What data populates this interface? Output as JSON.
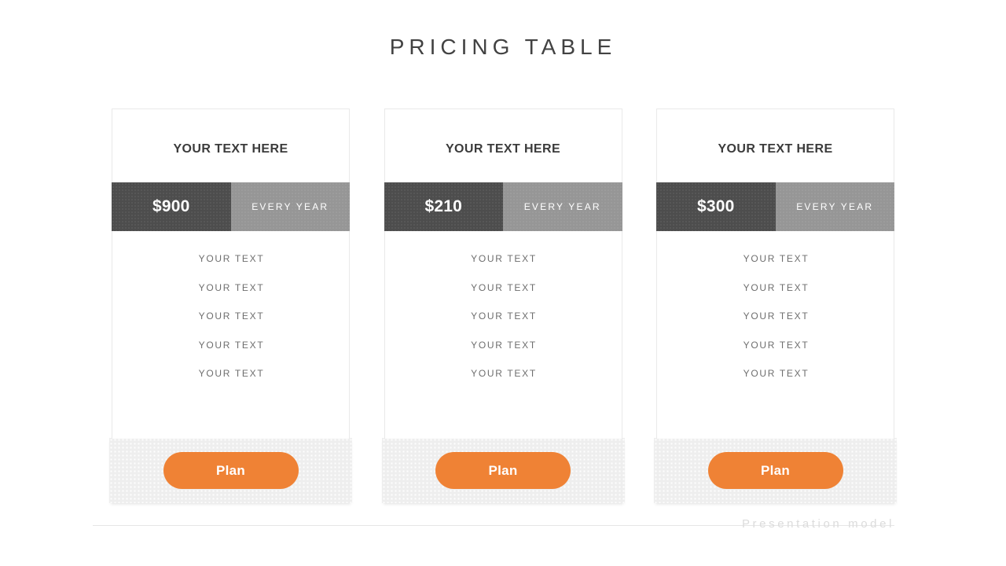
{
  "slide": {
    "title": "PRICING TABLE",
    "caption": "Presentation model",
    "accent_color": "#ef8235",
    "dark_gray": "#4d4d4d",
    "mid_gray": "#969696",
    "footer_gray": "#eeeeee"
  },
  "plans": [
    {
      "title": "YOUR TEXT HERE",
      "price": "$900",
      "period": "EVERY YEAR",
      "features": [
        "YOUR TEXT",
        "YOUR TEXT",
        "YOUR TEXT",
        "YOUR TEXT",
        "YOUR TEXT"
      ],
      "button_label": "Plan"
    },
    {
      "title": "YOUR TEXT HERE",
      "price": "$210",
      "period": "EVERY YEAR",
      "features": [
        "YOUR TEXT",
        "YOUR TEXT",
        "YOUR TEXT",
        "YOUR TEXT",
        "YOUR TEXT"
      ],
      "button_label": "Plan"
    },
    {
      "title": "YOUR TEXT HERE",
      "price": "$300",
      "period": "EVERY YEAR",
      "features": [
        "YOUR TEXT",
        "YOUR TEXT",
        "YOUR TEXT",
        "YOUR TEXT",
        "YOUR TEXT"
      ],
      "button_label": "Plan"
    }
  ]
}
